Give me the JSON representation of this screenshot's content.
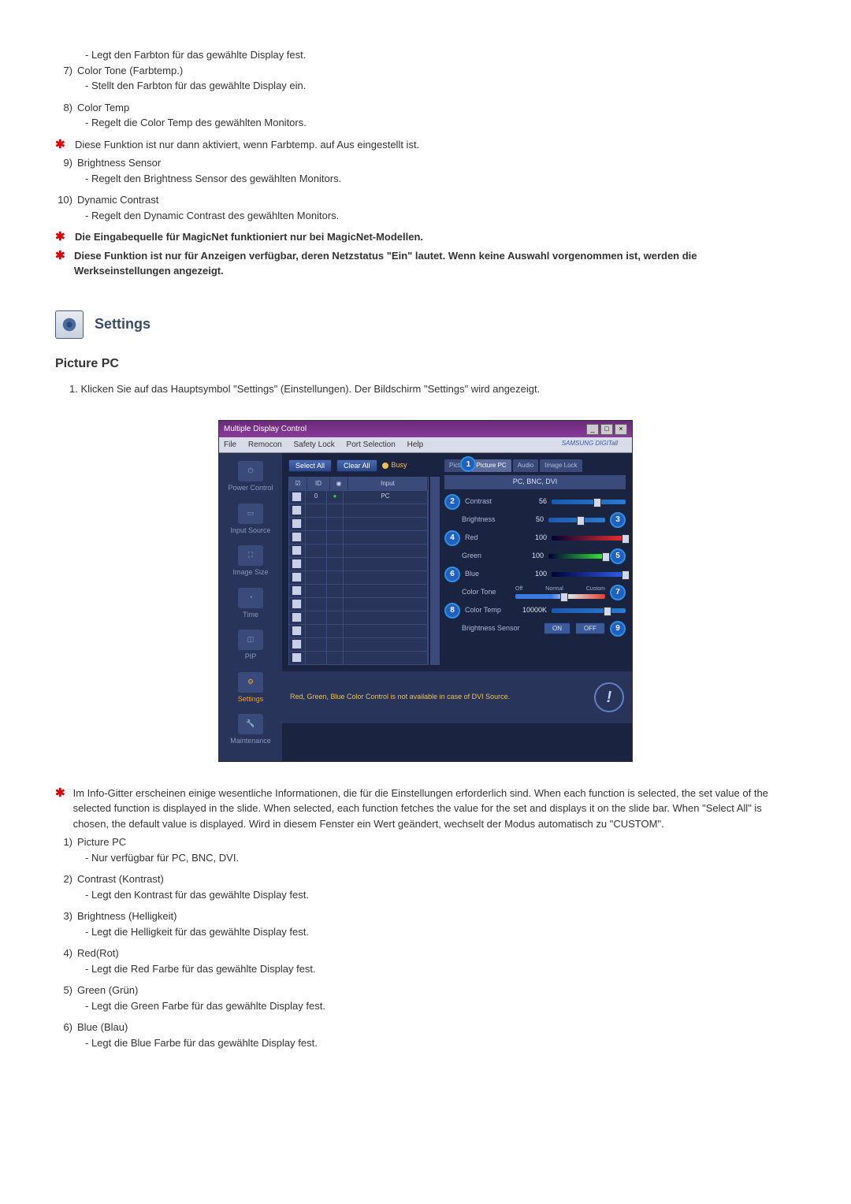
{
  "prior_items": [
    {
      "num": "",
      "title": "",
      "sub": "- Legt den Farbton für das gewählte Display fest."
    },
    {
      "num": "7)",
      "title": "Color Tone (Farbtemp.)",
      "sub": "- Stellt den Farbton für das gewählte Display ein."
    },
    {
      "num": "8)",
      "title": "Color Temp",
      "sub": "- Regelt die Color Temp des gewählten Monitors."
    }
  ],
  "star_note_1": "Diese Funktion ist nur dann aktiviert, wenn Farbtemp. auf Aus eingestellt ist.",
  "prior_items_2": [
    {
      "num": "9)",
      "title": "Brightness Sensor",
      "sub": "- Regelt den Brightness Sensor des gewählten Monitors."
    },
    {
      "num": "10)",
      "title": "Dynamic Contrast",
      "sub": "- Regelt den Dynamic Contrast des gewählten Monitors."
    }
  ],
  "star_bold_1": "Die Eingabequelle für MagicNet funktioniert nur bei MagicNet-Modellen.",
  "star_bold_2": "Diese Funktion ist nur für Anzeigen verfügbar, deren Netzstatus \"Ein\" lautet. Wenn keine Auswahl vorgenommen ist, werden die Werkseinstellungen angezeigt.",
  "section_title": "Settings",
  "sub_heading": "Picture PC",
  "step_1": "1. Klicken Sie auf das Hauptsymbol \"Settings\" (Einstellungen). Der Bildschirm \"Settings\" wird angezeigt.",
  "app": {
    "title": "Multiple Display Control",
    "menu": [
      "File",
      "Remocon",
      "Safety Lock",
      "Port Selection",
      "Help"
    ],
    "brand": "SAMSUNG DIGITall",
    "sidebar": [
      {
        "label": "Power Control"
      },
      {
        "label": "Input Source"
      },
      {
        "label": "Image Size"
      },
      {
        "label": "Time"
      },
      {
        "label": "PIP"
      },
      {
        "label": "Settings",
        "active": true
      },
      {
        "label": "Maintenance"
      }
    ],
    "select_all": "Select All",
    "clear_all": "Clear All",
    "busy": "Busy",
    "grid_head": [
      "",
      "ID",
      "",
      "Input"
    ],
    "grid_first_row": {
      "id": "0",
      "input": "PC"
    },
    "tabs": [
      {
        "label": "Pictur"
      },
      {
        "label": "Picture PC",
        "active": true
      },
      {
        "label": "Audio"
      },
      {
        "label": "Image Lock"
      }
    ],
    "mode": "PC, BNC, DVI",
    "controls": {
      "contrast": {
        "label": "Contrast",
        "val": "56",
        "num": "2"
      },
      "brightness": {
        "label": "Brightness",
        "val": "50",
        "num": "3"
      },
      "red": {
        "label": "Red",
        "val": "100",
        "num": "4"
      },
      "green": {
        "label": "Green",
        "val": "100",
        "num": "5"
      },
      "blue": {
        "label": "Blue",
        "val": "100",
        "num": "6"
      },
      "color_tone": {
        "label": "Color Tone",
        "off": "Off",
        "normal": "Normal",
        "custom": "Custom",
        "num": "7"
      },
      "color_temp": {
        "label": "Color Temp",
        "val": "10000K",
        "num": "8"
      },
      "bright_sensor": {
        "label": "Brightness Sensor",
        "on": "ON",
        "off": "OFF",
        "num": "9"
      }
    },
    "tab1_num": "1",
    "footer_text": "Red, Green, Blue Color Control is not available in case of DVI Source."
  },
  "after_star": "Im Info-Gitter erscheinen einige wesentliche Informationen, die für die Einstellungen erforderlich sind. When each function is selected, the set value of the selected function is displayed in the slide. When selected, each function fetches the value for the set and displays it on the slide bar. When \"Select All\" is chosen, the default value is displayed. Wird in diesem Fenster ein Wert geändert, wechselt der Modus automatisch zu \"CUSTOM\".",
  "after_items": [
    {
      "num": "1)",
      "title": "Picture PC",
      "sub": "- Nur verfügbar für PC, BNC, DVI."
    },
    {
      "num": "2)",
      "title": "Contrast (Kontrast)",
      "sub": "- Legt den Kontrast für das gewählte Display fest."
    },
    {
      "num": "3)",
      "title": "Brightness (Helligkeit)",
      "sub": "- Legt die Helligkeit für das gewählte Display fest."
    },
    {
      "num": "4)",
      "title": "Red(Rot)",
      "sub": "- Legt die Red Farbe für das gewählte Display fest."
    },
    {
      "num": "5)",
      "title": "Green (Grün)",
      "sub": "- Legt die Green Farbe für das gewählte Display fest."
    },
    {
      "num": "6)",
      "title": "Blue (Blau)",
      "sub": "- Legt die Blue Farbe für das gewählte Display fest."
    }
  ]
}
